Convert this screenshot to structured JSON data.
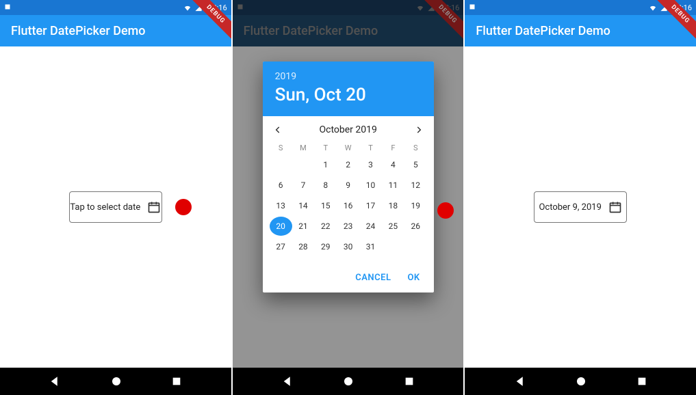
{
  "status": {
    "time": "2:16"
  },
  "app": {
    "title": "Flutter DatePicker Demo",
    "debug_label": "DEBUG"
  },
  "screen1": {
    "field_label": "Tap to select date"
  },
  "screen2": {
    "picker": {
      "year": "2019",
      "date_label": "Sun, Oct 20",
      "month_label": "October 2019",
      "weekdays": [
        "S",
        "M",
        "T",
        "W",
        "T",
        "F",
        "S"
      ],
      "first_weekday_index": 2,
      "days_in_month": 31,
      "selected_day": 20,
      "cancel": "CANCEL",
      "ok": "OK"
    }
  },
  "screen3": {
    "field_label": "October 9, 2019"
  }
}
